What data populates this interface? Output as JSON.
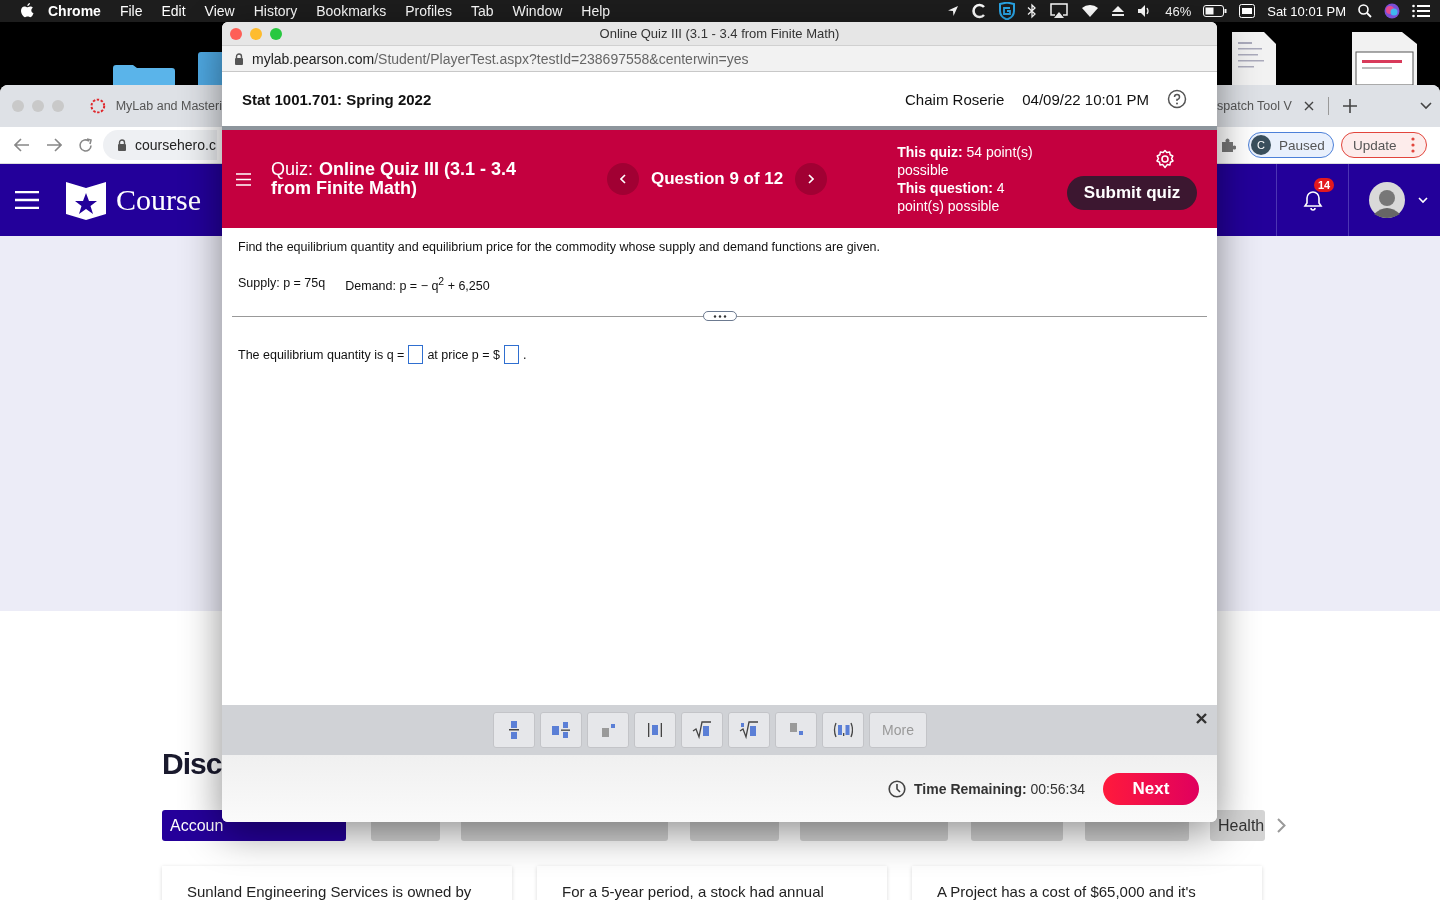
{
  "menu_bar": {
    "app": "Chrome",
    "items": [
      "File",
      "Edit",
      "View",
      "History",
      "Bookmarks",
      "Profiles",
      "Tab",
      "Window",
      "Help"
    ],
    "battery": "46%",
    "clock": "Sat 10:01 PM"
  },
  "background_browser": {
    "tab_title": "MyLab and Masteri",
    "right_tab_title": "spatch Tool V",
    "url": "coursehero.c",
    "profile_initial": "C",
    "profile_status": "Paused",
    "update_button": "Update",
    "site_name": "Course",
    "notification_count": "14",
    "heading": "Disc",
    "categories": [
      {
        "label": "Accoun",
        "selected": true
      },
      {
        "selected": false
      },
      {
        "selected": false
      },
      {
        "selected": false
      },
      {
        "selected": false
      },
      {
        "selected": false
      },
      {
        "selected": false
      },
      {
        "label": "Health",
        "selected": false
      }
    ],
    "cards": [
      "Sunland Engineering Services is owned by",
      "For a 5-year period, a stock had annual",
      "A Project has a cost of $65,000 and it's"
    ]
  },
  "popup": {
    "title": "Online Quiz III (3.1 - 3.4 from Finite Math)",
    "url_host": "mylab.pearson.com",
    "url_path": "/Student/PlayerTest.aspx?testId=238697558&centerwin=yes",
    "course": "Stat 1001.701: Spring 2022",
    "student": "Chaim Roserie",
    "datetime": "04/09/22 10:01 PM",
    "quiz_label": "Quiz:",
    "quiz_name": "Online Quiz III (3.1 - 3.4 from Finite Math)",
    "question_position": "Question 9 of 12",
    "quiz_points": "**This quiz:** 54 point(s) possible",
    "question_points": "**This question:** 4 point(s) possible",
    "submit": "Submit quiz",
    "instructions": "Find the equilibrium quantity and equilibrium price for the commodity whose supply and demand functions are given.",
    "supply": "Supply: p = 75q",
    "demand": "Demand: p = − q$^{2}$ + 6,250",
    "answer": {
      "before": "The equilibrium quantity is q =",
      "middle": "at price p = $",
      "after": "."
    },
    "toolbar": [
      {
        "kind": "fraction"
      },
      {
        "kind": "mixed-number"
      },
      {
        "kind": "exponent"
      },
      {
        "kind": "absolute-value"
      },
      {
        "kind": "square-root"
      },
      {
        "kind": "nth-root"
      },
      {
        "kind": "subscript"
      },
      {
        "kind": "ordered-pair"
      },
      {
        "kind": "more",
        "label": "More",
        "disabled": true
      }
    ],
    "time_label": "Time Remaining:",
    "time": "00:56:34",
    "next": "Next"
  }
}
